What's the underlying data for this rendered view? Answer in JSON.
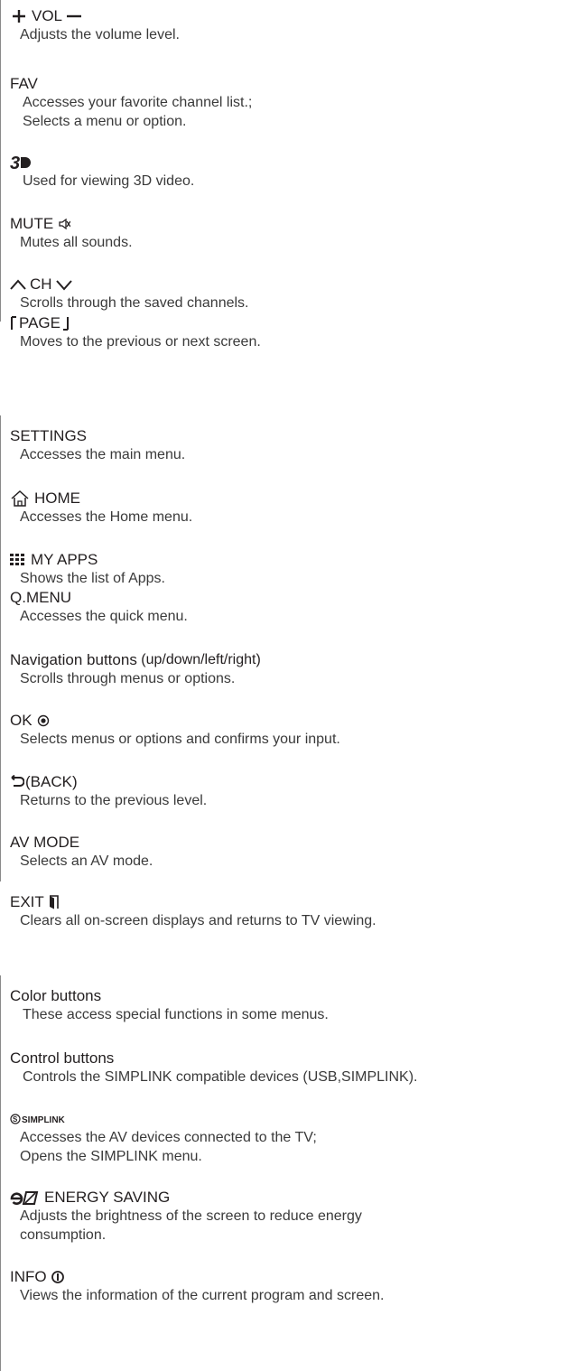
{
  "section1": {
    "items": [
      {
        "title_parts": [
          "VOL"
        ],
        "desc": "Adjusts the volume level."
      },
      {
        "title_parts": [
          "FAV"
        ],
        "desc_lines": [
          "Accesses your favorite channel list.;",
          "Selects a menu or option."
        ]
      },
      {
        "title_parts": [],
        "desc": "Used for viewing 3D video."
      },
      {
        "title_parts": [
          "MUTE"
        ],
        "desc": "Mutes all sounds."
      },
      {
        "title_parts": [
          "CH"
        ],
        "desc": "Scrolls through the saved channels."
      },
      {
        "title_parts": [
          "PAGE"
        ],
        "desc": "Moves to the previous or next screen."
      }
    ]
  },
  "section2": {
    "items": [
      {
        "title_parts": [
          "SETTINGS"
        ],
        "desc": "Accesses the main menu."
      },
      {
        "title_parts": [
          "HOME"
        ],
        "desc": "Accesses the Home menu."
      },
      {
        "title_parts": [
          "MY APPS"
        ],
        "desc": "Shows the list of Apps."
      },
      {
        "title_parts": [
          "Q.MENU"
        ],
        "desc": "Accesses the quick menu."
      },
      {
        "title_parts": [
          "Navigation buttons",
          " (up/down/left/right)"
        ],
        "desc": "Scrolls through menus or options."
      },
      {
        "title_parts": [
          "OK"
        ],
        "desc": "Selects menus or options and confirms your input."
      },
      {
        "title_parts": [
          "(BACK)"
        ],
        "desc": "Returns to the previous level."
      },
      {
        "title_parts": [
          "AV MODE"
        ],
        "desc": "Selects an AV mode."
      },
      {
        "title_parts": [
          "EXIT"
        ],
        "desc": "Clears all on-screen displays and returns to TV viewing."
      }
    ]
  },
  "section3": {
    "items": [
      {
        "title_parts": [
          "Color buttons"
        ],
        "desc": "These access special functions in some menus."
      },
      {
        "title_parts": [
          "Control buttons"
        ],
        "desc": "Controls the SIMPLINK compatible devices (USB,SIMPLINK)."
      },
      {
        "title_parts": [
          "SIMPLINK"
        ],
        "desc_lines": [
          "Accesses the AV devices connected to the TV;",
          "Opens the SIMPLINK menu."
        ]
      },
      {
        "title_parts": [
          "ENERGY SAVING"
        ],
        "desc_lines": [
          "Adjusts the brightness of the screen to reduce energy",
          "consumption."
        ]
      },
      {
        "title_parts": [
          "INFO"
        ],
        "desc": "Views the information of the current program and screen."
      }
    ]
  },
  "icons": {
    "vol": [
      "plus-icon",
      "minus-icon"
    ],
    "three_d": "3d-logo-icon",
    "mute": "mute-icon",
    "ch": [
      "chevron-up-icon",
      "chevron-down-icon"
    ],
    "page": [
      "page-up-bracket-icon",
      "page-down-bracket-icon"
    ],
    "home": "home-icon",
    "my_apps": "grid-icon",
    "ok": "ok-circle-icon",
    "back": "back-arrow-icon",
    "exit": "exit-icon",
    "simplink": "simplink-logo-icon",
    "energy": "energy-saving-logo-icon",
    "info": "info-circle-icon"
  }
}
